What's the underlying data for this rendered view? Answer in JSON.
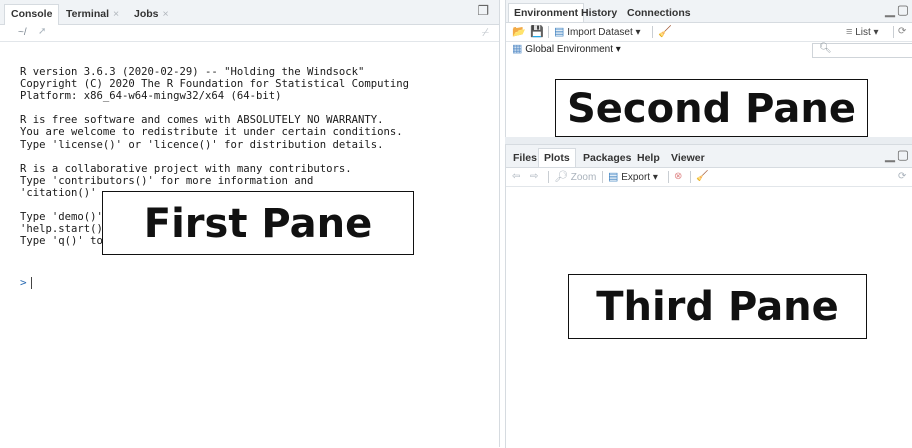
{
  "console_pane": {
    "tabs": [
      {
        "label": "Console"
      },
      {
        "label": "Terminal",
        "close": "×"
      },
      {
        "label": "Jobs",
        "close": "×"
      }
    ],
    "path": "~/",
    "lines": [
      "R version 3.6.3 (2020-02-29) -- \"Holding the Windsock\"",
      "Copyright (C) 2020 The R Foundation for Statistical Computing",
      "Platform: x86_64-w64-mingw32/x64 (64-bit)",
      "",
      "R is free software and comes with ABSOLUTELY NO WARRANTY.",
      "You are welcome to redistribute it under certain conditions.",
      "Type 'license()' or 'licence()' for distribution details.",
      "",
      "R is a collaborative project with many contributors.",
      "Type 'contributors()' for more information and",
      "'citation()'                                          .",
      "",
      "Type 'demo()'",
      "'help.start()'",
      "Type 'q()' to quit R."
    ],
    "prompt": ">",
    "overlay_label": "First Pane"
  },
  "environment_pane": {
    "tabs": [
      "Environment",
      "History",
      "Connections"
    ],
    "import_dataset_label": "Import Dataset ▾",
    "list_view_label": "List ▾",
    "global_env_label": "Global Environment ▾",
    "search_placeholder": "",
    "overlay_label": "Second Pane"
  },
  "files_pane": {
    "tabs": [
      "Files",
      "Plots",
      "Packages",
      "Help",
      "Viewer"
    ],
    "zoom_label": "Zoom",
    "export_label": "Export ▾",
    "overlay_label": "Third Pane"
  }
}
